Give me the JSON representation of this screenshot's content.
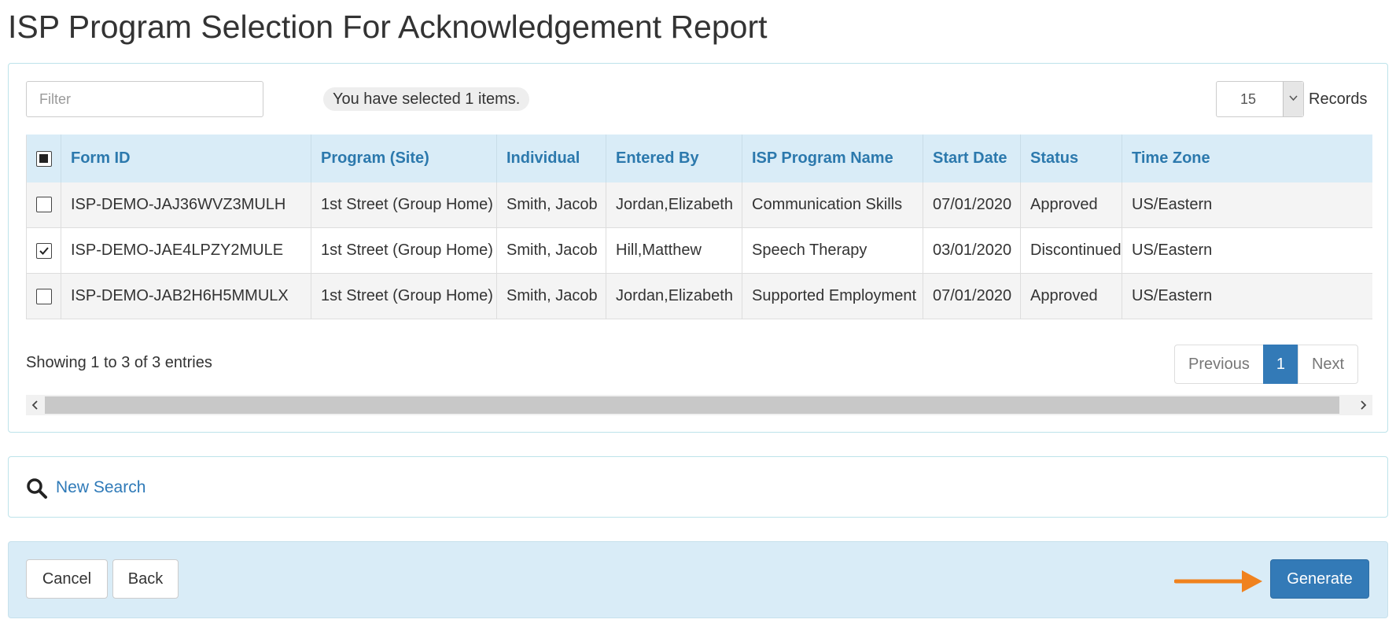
{
  "page": {
    "title": "ISP Program Selection For Acknowledgement Report"
  },
  "toolbar": {
    "filter_placeholder": "Filter",
    "selected_text": "You have selected 1 items.",
    "records_value": "15",
    "records_label": "Records"
  },
  "table": {
    "columns": [
      "Form ID",
      "Program (Site)",
      "Individual",
      "Entered By",
      "ISP Program Name",
      "Start Date",
      "Status",
      "Time Zone"
    ],
    "select_all_state": "indeterminate",
    "rows": [
      {
        "checked": false,
        "form_id": "ISP-DEMO-JAJ36WVZ3MULH",
        "program": "1st Street (Group Home)",
        "individual": "Smith, Jacob",
        "entered_by": "Jordan,Elizabeth",
        "isp_program_name": "Communication Skills",
        "start_date": "07/01/2020",
        "status": "Approved",
        "time_zone": "US/Eastern"
      },
      {
        "checked": true,
        "form_id": "ISP-DEMO-JAE4LPZY2MULE",
        "program": "1st Street (Group Home)",
        "individual": "Smith, Jacob",
        "entered_by": "Hill,Matthew",
        "isp_program_name": "Speech Therapy",
        "start_date": "03/01/2020",
        "status": "Discontinued",
        "time_zone": "US/Eastern"
      },
      {
        "checked": false,
        "form_id": "ISP-DEMO-JAB2H6H5MMULX",
        "program": "1st Street (Group Home)",
        "individual": "Smith, Jacob",
        "entered_by": "Jordan,Elizabeth",
        "isp_program_name": "Supported Employment",
        "start_date": "07/01/2020",
        "status": "Approved",
        "time_zone": "US/Eastern"
      }
    ]
  },
  "pagination": {
    "info": "Showing 1 to 3 of 3 entries",
    "previous_label": "Previous",
    "current_page": "1",
    "next_label": "Next"
  },
  "search_panel": {
    "icon": "search-icon",
    "link_label": "New Search"
  },
  "footer": {
    "cancel_label": "Cancel",
    "back_label": "Back",
    "generate_label": "Generate",
    "annotation_arrow_color": "#f0821e"
  },
  "colors": {
    "header_bg": "#d9ecf7",
    "header_text": "#2c79ad",
    "primary": "#337ab7",
    "link": "#2f7ab8",
    "panel_border": "#bde3ea"
  }
}
